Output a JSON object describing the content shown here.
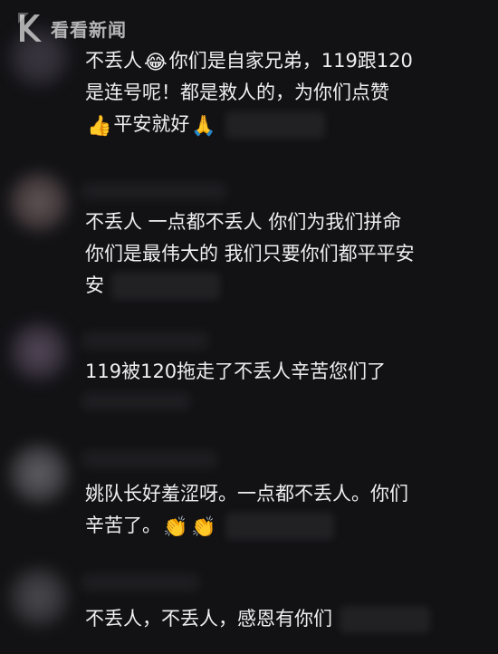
{
  "watermark": {
    "brand_text": "看看新闻",
    "logo_icon": "kankan-news-logo-icon"
  },
  "colors": {
    "background": "#121215",
    "comment_text": "#EFEFEF"
  },
  "comments": [
    {
      "lines": [
        {
          "pre": "不丢人",
          "emoji": "😂",
          "post": "你们是自家兄弟，119跟120"
        },
        {
          "pre": "是连号呢！都是救人的，为你们点赞",
          "emoji": "",
          "post": ""
        },
        {
          "pre": "",
          "emoji": "👍",
          "post": "平安就好",
          "emoji2": "🙏"
        }
      ]
    },
    {
      "lines": [
        {
          "pre": "不丢人 一点都不丢人 你们为我们拼命",
          "emoji": "",
          "post": ""
        },
        {
          "pre": "你们是最伟大的 我们只要你们都平平安",
          "emoji": "",
          "post": ""
        },
        {
          "pre": "安",
          "emoji": "",
          "post": ""
        }
      ]
    },
    {
      "lines": [
        {
          "pre": "119被120拖走了不丢人辛苦您们了",
          "emoji": "",
          "post": ""
        }
      ]
    },
    {
      "lines": [
        {
          "pre": "姚队长好羞涩呀。一点都不丢人。你们",
          "emoji": "",
          "post": ""
        },
        {
          "pre": "辛苦了。",
          "emoji": "👏",
          "post": "",
          "emoji2": "👏"
        }
      ]
    },
    {
      "lines": [
        {
          "pre": "不丢人，不丢人，感恩有你们",
          "emoji": "",
          "post": ""
        }
      ]
    }
  ]
}
